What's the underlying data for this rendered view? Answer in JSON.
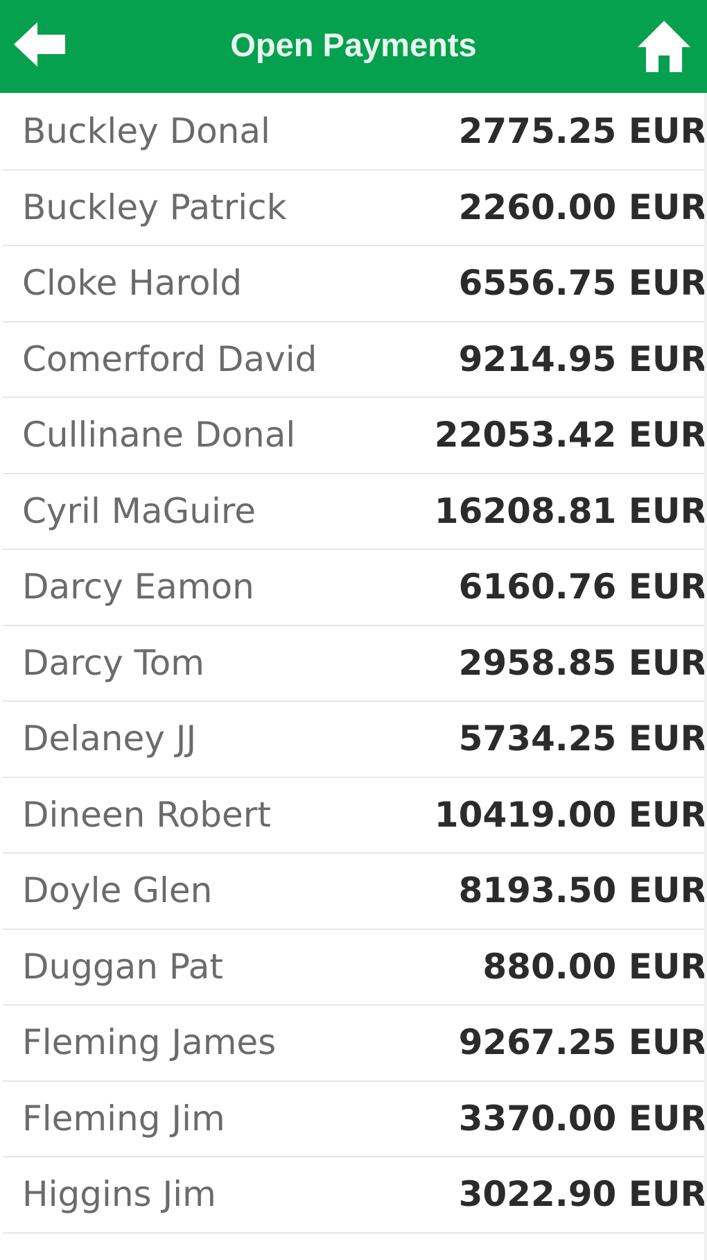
{
  "header": {
    "title": "Open Payments",
    "back_icon": "arrow-left-icon",
    "home_icon": "home-icon",
    "bg_color": "#06a14e"
  },
  "payments": [
    {
      "name": "Buckley Donal",
      "amount": "2775.25 EUR"
    },
    {
      "name": "Buckley Patrick",
      "amount": "2260.00 EUR"
    },
    {
      "name": "Cloke Harold",
      "amount": "6556.75 EUR"
    },
    {
      "name": "Comerford David",
      "amount": "9214.95 EUR"
    },
    {
      "name": "Cullinane Donal",
      "amount": "22053.42 EUR"
    },
    {
      "name": "Cyril MaGuire",
      "amount": "16208.81 EUR"
    },
    {
      "name": "Darcy Eamon",
      "amount": "6160.76 EUR"
    },
    {
      "name": "Darcy Tom",
      "amount": "2958.85 EUR"
    },
    {
      "name": "Delaney JJ",
      "amount": "5734.25 EUR"
    },
    {
      "name": "Dineen Robert",
      "amount": "10419.00 EUR"
    },
    {
      "name": "Doyle Glen",
      "amount": "8193.50 EUR"
    },
    {
      "name": "Duggan Pat",
      "amount": "880.00 EUR"
    },
    {
      "name": "Fleming James",
      "amount": "9267.25 EUR"
    },
    {
      "name": "Fleming Jim",
      "amount": "3370.00 EUR"
    },
    {
      "name": "Higgins Jim",
      "amount": "3022.90 EUR"
    }
  ]
}
